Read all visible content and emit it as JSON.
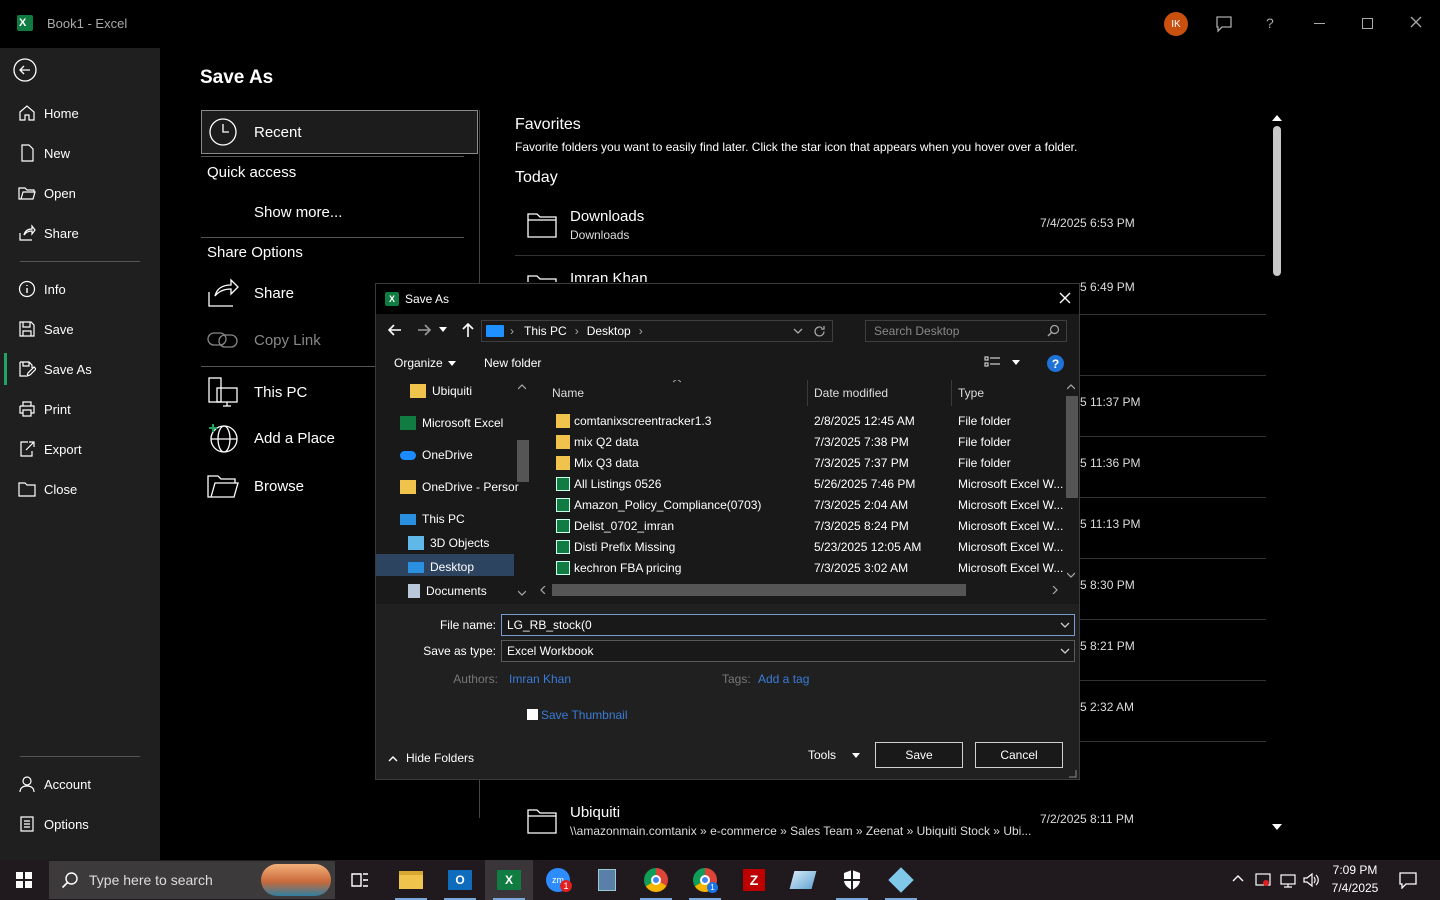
{
  "titlebar": {
    "app_title": "Book1  -  Excel",
    "user_initials": "IK",
    "help_label": "?"
  },
  "sidebar": {
    "items": [
      {
        "label": "Home",
        "icon": "home-icon"
      },
      {
        "label": "New",
        "icon": "new-doc-icon"
      },
      {
        "label": "Open",
        "icon": "folder-open-icon"
      },
      {
        "label": "Share",
        "icon": "share-icon"
      },
      {
        "label": "Info",
        "icon": "info-icon"
      },
      {
        "label": "Save",
        "icon": "save-icon"
      },
      {
        "label": "Save As",
        "icon": "save-as-icon"
      },
      {
        "label": "Print",
        "icon": "print-icon"
      },
      {
        "label": "Export",
        "icon": "export-icon"
      },
      {
        "label": "Close",
        "icon": "folder-close-icon"
      }
    ],
    "bottom": [
      {
        "label": "Account",
        "icon": "person-icon"
      },
      {
        "label": "Options",
        "icon": "options-icon"
      }
    ]
  },
  "saveas": {
    "page_title": "Save As",
    "recent_label": "Recent",
    "quick_access_label": "Quick access",
    "show_more_label": "Show more...",
    "share_options_label": "Share Options",
    "share_label": "Share",
    "copy_link_label": "Copy Link",
    "this_pc_label": "This PC",
    "add_place_label": "Add a Place",
    "browse_label": "Browse"
  },
  "favorites": {
    "heading": "Favorites",
    "description": "Favorite folders you want to easily find later. Click the star icon that appears when you hover over a folder.",
    "today_label": "Today",
    "rows": [
      {
        "name": "Downloads",
        "path": "Downloads",
        "date": "7/4/2025 6:53 PM"
      },
      {
        "name": "Imran Khan",
        "path": "",
        "date": "5 6:49 PM"
      },
      {
        "name": "Ubiquiti",
        "path": "\\\\amazonmain.comtanix » e-commerce » Sales Team » Zeenat » Ubiquiti Stock » Ubi...",
        "date": "7/2/2025 8:11 PM"
      }
    ],
    "partial_dates": [
      "5 11:37 PM",
      "5 11:36 PM",
      "5 11:13 PM",
      "5 8:30 PM",
      "5 8:21 PM",
      "5 2:32 AM"
    ]
  },
  "dialog": {
    "title": "Save As",
    "breadcrumb": [
      "This PC",
      "Desktop"
    ],
    "search_placeholder": "Search Desktop",
    "organize_label": "Organize",
    "new_folder_label": "New folder",
    "tree": [
      "Ubiquiti",
      "Microsoft Excel",
      "OneDrive",
      "OneDrive - Persor",
      "This PC",
      "3D Objects",
      "Desktop",
      "Documents"
    ],
    "columns": {
      "name": "Name",
      "date": "Date modified",
      "type": "Type"
    },
    "files": [
      {
        "name": "comtanixscreentracker1.3",
        "date": "2/8/2025 12:45 AM",
        "type": "File folder",
        "kind": "folder"
      },
      {
        "name": "mix Q2 data",
        "date": "7/3/2025 7:38 PM",
        "type": "File folder",
        "kind": "folder"
      },
      {
        "name": "Mix Q3 data",
        "date": "7/3/2025 7:37 PM",
        "type": "File folder",
        "kind": "folder"
      },
      {
        "name": "All Listings 0526",
        "date": "5/26/2025 7:46 PM",
        "type": "Microsoft Excel W...",
        "kind": "excel"
      },
      {
        "name": "Amazon_Policy_Compliance(0703)",
        "date": "7/3/2025 2:04 AM",
        "type": "Microsoft Excel W...",
        "kind": "excel"
      },
      {
        "name": "Delist_0702_imran",
        "date": "7/3/2025 8:24 PM",
        "type": "Microsoft Excel W...",
        "kind": "excel"
      },
      {
        "name": "Disti Prefix Missing",
        "date": "5/23/2025 12:05 AM",
        "type": "Microsoft Excel W...",
        "kind": "excel"
      },
      {
        "name": "kechron FBA pricing",
        "date": "7/3/2025 3:02 AM",
        "type": "Microsoft Excel W...",
        "kind": "excel"
      }
    ],
    "file_name_label": "File name:",
    "file_name_value": "LG_RB_stock(0",
    "save_type_label": "Save as type:",
    "save_type_value": "Excel Workbook",
    "authors_label": "Authors:",
    "authors_value": "Imran Khan",
    "tags_label": "Tags:",
    "tags_value": "Add a tag",
    "thumbnail_label": "Save Thumbnail",
    "hide_folders_label": "Hide Folders",
    "tools_label": "Tools",
    "save_label": "Save",
    "cancel_label": "Cancel"
  },
  "taskbar": {
    "search_placeholder": "Type here to search",
    "time": "7:09 PM",
    "date": "7/4/2025",
    "zoom_badge": "1",
    "chrome_badge": "1"
  },
  "colors": {
    "accent_orange": "#ca5010",
    "excel_green": "#107c41",
    "link_blue": "#3a7bd5",
    "folder_yellow": "#f0c44c"
  }
}
